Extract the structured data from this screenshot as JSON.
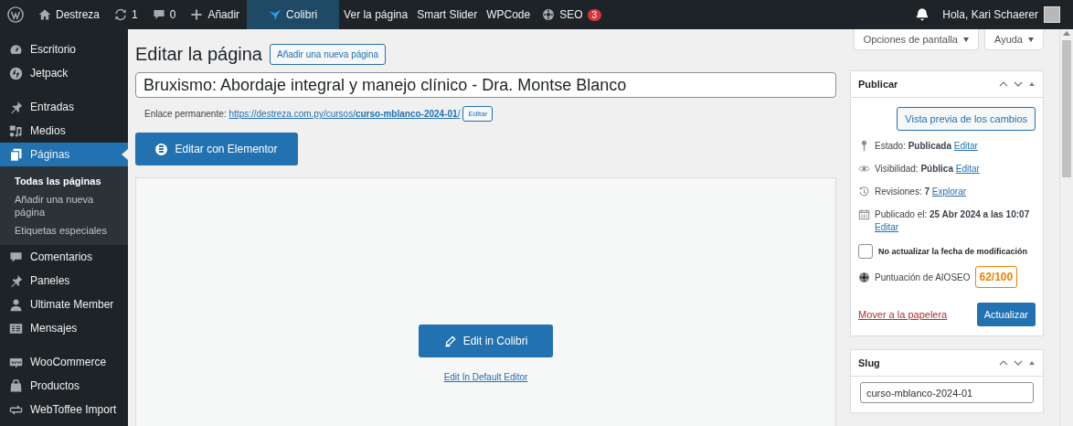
{
  "admin_bar": {
    "left": [
      {
        "kind": "wordpress",
        "highlighted": false
      },
      {
        "kind": "home",
        "label": "Destreza",
        "highlighted": false
      },
      {
        "kind": "updates",
        "label": "1",
        "highlighted": false
      },
      {
        "kind": "comments",
        "label": "0",
        "highlighted": false
      },
      {
        "kind": "add",
        "label": "Añadir",
        "highlighted": false
      },
      {
        "kind": "colibri",
        "label": "Colibri",
        "highlighted": true
      },
      {
        "kind": "text",
        "label": "Ver la página",
        "highlighted": false
      },
      {
        "kind": "text",
        "label": "Smart Slider",
        "highlighted": false
      },
      {
        "kind": "text",
        "label": "WPCode",
        "highlighted": false
      },
      {
        "kind": "seo",
        "label": "SEO",
        "badge": "3",
        "highlighted": false
      }
    ],
    "greeting": "Hola, Kari Schaerer"
  },
  "sidebar": {
    "groups": [
      [
        {
          "kind": "dashboard",
          "label": "Escritorio",
          "selected": false
        },
        {
          "kind": "jetpack",
          "label": "Jetpack",
          "selected": false
        }
      ],
      [
        {
          "kind": "pin",
          "label": "Entradas",
          "selected": false
        },
        {
          "kind": "media",
          "label": "Medios",
          "selected": false
        },
        {
          "kind": "pages",
          "label": "Páginas",
          "selected": true,
          "submenu": [
            {
              "label": "Todas las páginas",
              "selected": true
            },
            {
              "label": "Añadir una nueva página",
              "selected": false
            },
            {
              "label": "Etiquetas especiales",
              "selected": false
            }
          ]
        },
        {
          "kind": "comments",
          "label": "Comentarios",
          "selected": false
        },
        {
          "kind": "pin",
          "label": "Paneles",
          "selected": false
        },
        {
          "kind": "user",
          "label": "Ultimate Member",
          "selected": false
        },
        {
          "kind": "messages",
          "label": "Mensajes",
          "selected": false
        }
      ],
      [
        {
          "kind": "woo",
          "label": "WooCommerce",
          "selected": false
        },
        {
          "kind": "products",
          "label": "Productos",
          "selected": false
        },
        {
          "kind": "import",
          "label": "WebToffee Import",
          "selected": false
        }
      ]
    ]
  },
  "screen_buttons": [
    "Opciones de pantalla",
    "Ayuda"
  ],
  "heading": "Editar la página",
  "add_new_button": "Añadir una nueva página",
  "title_field": {
    "value": "Bruxismo: Abordaje integral y manejo clínico - Dra. Montse Blanco"
  },
  "permalink": {
    "label": "Enlace permanente:",
    "url": "https://destreza.com.py/cursos/**curso-mblanco-2024-01**/",
    "edit_button": "Editar"
  },
  "elementor_button": "Editar con Elementor",
  "editor": {
    "primary_button": "Edit in Colibri",
    "secondary_link": "Edit In Default Editor"
  },
  "publish_box": {
    "title": "Publicar",
    "preview_button": "Vista previa de los cambios",
    "rows": [
      {
        "kind": "status",
        "text": "Estado: **Publicada**",
        "link": "Editar"
      },
      {
        "kind": "visibility",
        "text": "Visibilidad: **Pública**",
        "link": "Editar"
      },
      {
        "kind": "revisions",
        "text": "Revisiones: **7**",
        "link": "Explorar"
      },
      {
        "kind": "published",
        "text": "Publicado el: **25 Abr 2024 a las 10:07**",
        "link": "Editar"
      }
    ],
    "checkbox": {
      "label": "No actualizar la fecha de modificación",
      "checked": false
    },
    "seo_score": {
      "label": "Puntuación de AIOSEO",
      "score": "62/100"
    },
    "trash_link": "Mover a la papelera",
    "update_button": "Actualizar"
  },
  "slug_box": {
    "title": "Slug",
    "value": "curso-mblanco-2024-01"
  }
}
